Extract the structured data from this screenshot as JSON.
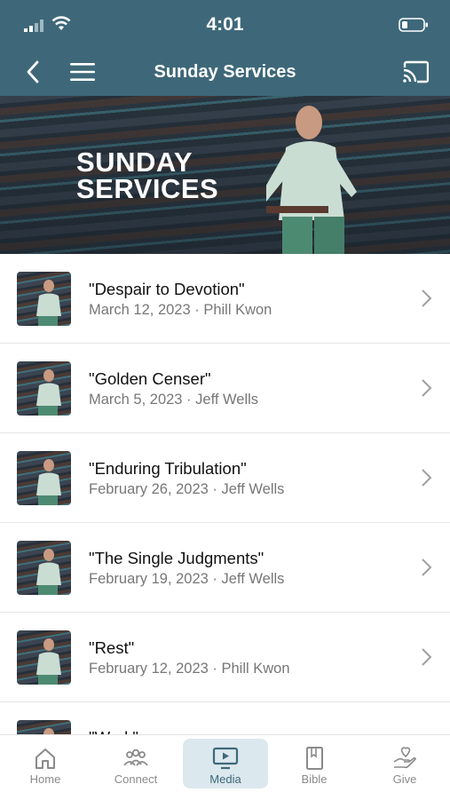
{
  "status": {
    "time": "4:01"
  },
  "nav": {
    "title": "Sunday Services"
  },
  "hero": {
    "line1": "SUNDAY",
    "line2": "SERVICES"
  },
  "items": [
    {
      "title": "\"Despair to Devotion\"",
      "meta": "March 12, 2023 · Phill Kwon"
    },
    {
      "title": "\"Golden Censer\"",
      "meta": "March 5, 2023 · Jeff Wells"
    },
    {
      "title": "\"Enduring Tribulation\"",
      "meta": "February 26, 2023 · Jeff Wells"
    },
    {
      "title": "\"The Single Judgments\"",
      "meta": "February 19, 2023 · Jeff Wells"
    },
    {
      "title": "\"Rest\"",
      "meta": "February 12, 2023 · Phill Kwon"
    },
    {
      "title": "\"Work\"",
      "meta": ""
    }
  ],
  "tabs": [
    {
      "label": "Home",
      "icon": "home-icon"
    },
    {
      "label": "Connect",
      "icon": "people-icon"
    },
    {
      "label": "Media",
      "icon": "media-icon"
    },
    {
      "label": "Bible",
      "icon": "book-icon"
    },
    {
      "label": "Give",
      "icon": "heart-hand-icon"
    }
  ],
  "colors": {
    "header": "#3e6879",
    "active_tab_bg": "#dbe8ee"
  }
}
